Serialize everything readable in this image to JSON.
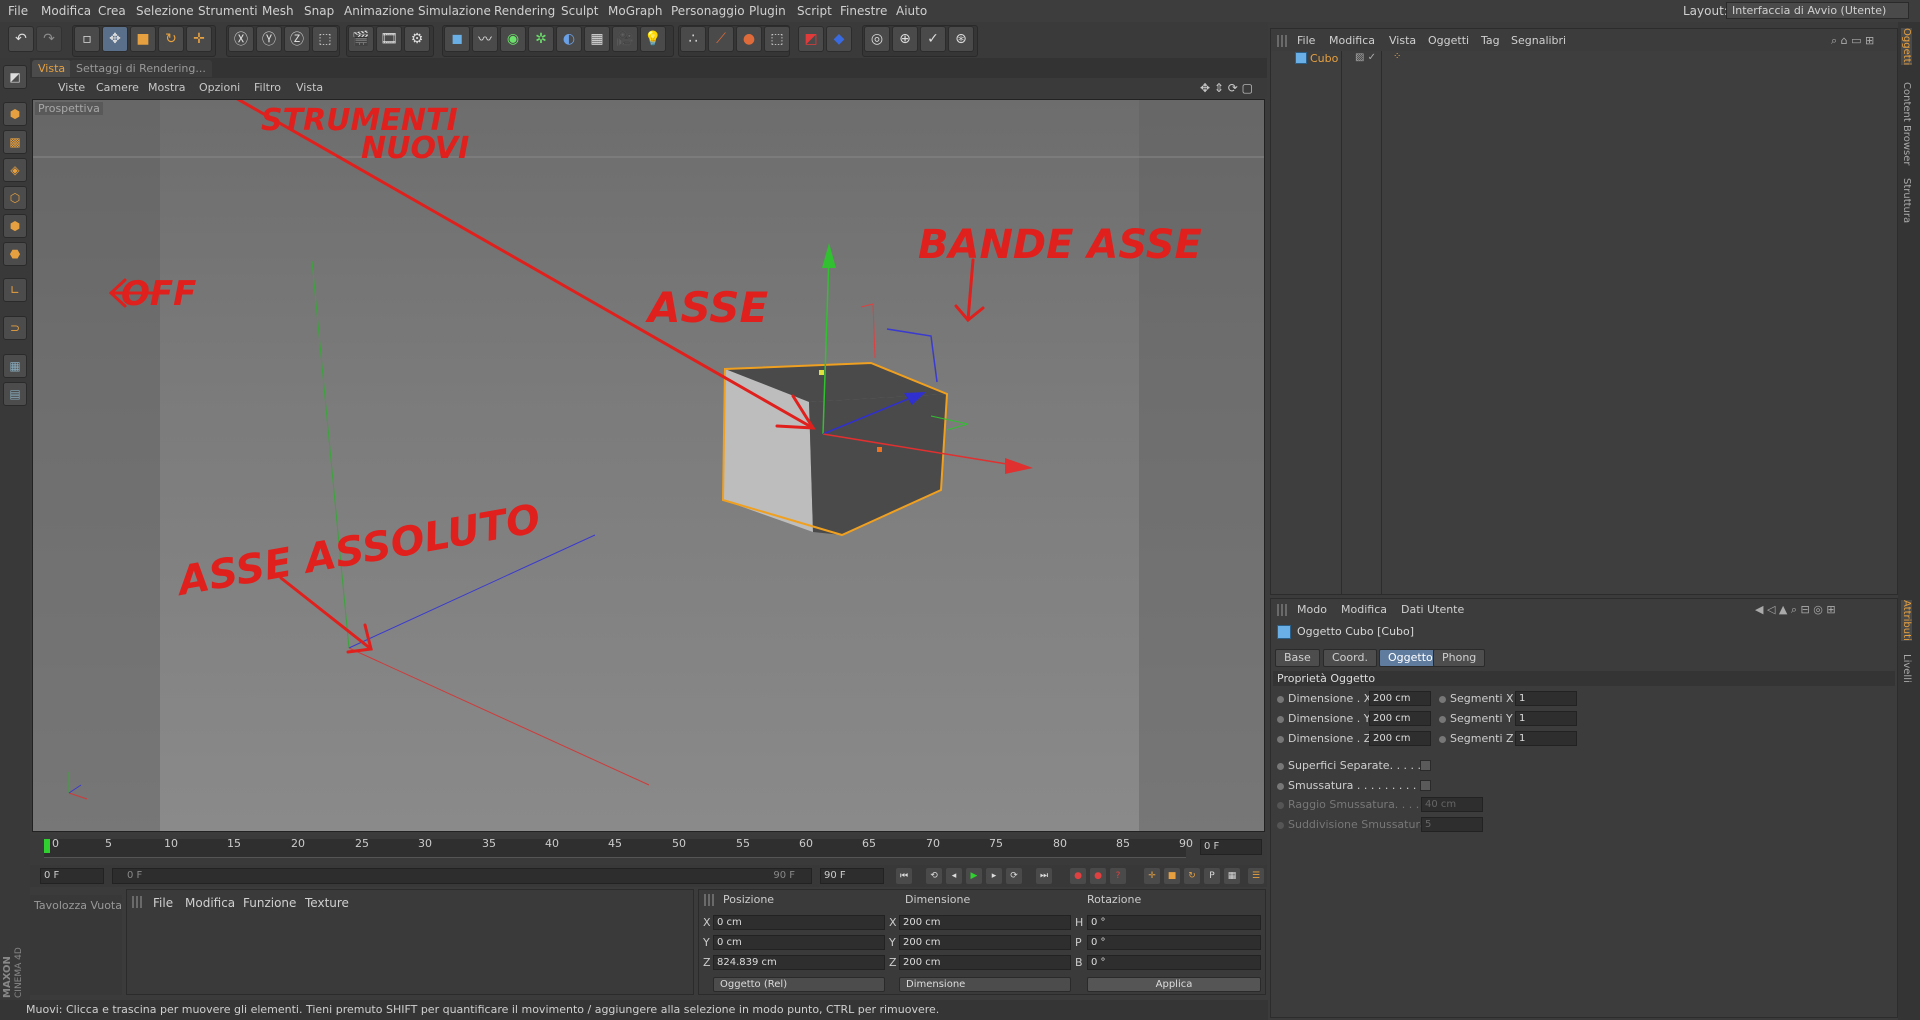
{
  "menubar": {
    "items": [
      "File",
      "Modifica",
      "Crea",
      "Selezione",
      "Strumenti",
      "Mesh",
      "Snap",
      "Animazione",
      "Simulazione",
      "Rendering",
      "Sculpt",
      "MoGraph",
      "Personaggio",
      "Plugin",
      "Script",
      "Finestre",
      "Aiuto"
    ],
    "layout_label": "Layout:",
    "layout_value": "Interfaccia di Avvio (Utente)"
  },
  "viewport": {
    "tabs": [
      "Vista",
      "Settaggi di Rendering..."
    ],
    "menu": [
      "Viste",
      "Camere",
      "Mostra",
      "Opzioni",
      "Filtro",
      "Vista"
    ],
    "label": "Prospettiva"
  },
  "annotations": {
    "strumenti": "STRUMENTI",
    "nuovi": "NUOVI",
    "bande_asse": "BANDE ASSE",
    "asse": "ASSE",
    "off": "OFF",
    "asse_assoluto": "ASSE ASSOLUTO"
  },
  "timeline": {
    "ticks": [
      "0",
      "5",
      "10",
      "15",
      "20",
      "25",
      "30",
      "35",
      "40",
      "45",
      "50",
      "55",
      "60",
      "65",
      "70",
      "75",
      "80",
      "85",
      "90"
    ],
    "current_frame": "0 F",
    "start": "0 F",
    "slider_start": "0 F",
    "slider_end": "90 F",
    "end": "90 F"
  },
  "palette": {
    "label": "Tavolozza Vuota"
  },
  "material_manager": {
    "menu": [
      "File",
      "Modifica",
      "Funzione",
      "Texture"
    ]
  },
  "coordinates": {
    "headers": [
      "Posizione",
      "Dimensione",
      "Rotazione"
    ],
    "pos": [
      {
        "axis": "X",
        "value": "0 cm"
      },
      {
        "axis": "Y",
        "value": "0 cm"
      },
      {
        "axis": "Z",
        "value": "824.839 cm"
      }
    ],
    "size": [
      {
        "axis": "X",
        "value": "200 cm"
      },
      {
        "axis": "Y",
        "value": "200 cm"
      },
      {
        "axis": "Z",
        "value": "200 cm"
      }
    ],
    "rot": [
      {
        "axis": "H",
        "value": "0 °"
      },
      {
        "axis": "P",
        "value": "0 °"
      },
      {
        "axis": "B",
        "value": "0 °"
      }
    ],
    "mode": "Oggetto (Rel)",
    "size_mode": "Dimensione",
    "apply": "Applica"
  },
  "status": "Muovi: Clicca e trascina per muovere gli elementi. Tieni premuto SHIFT per quantificare il movimento / aggiungere alla selezione in modo punto, CTRL per rimuovere.",
  "object_manager": {
    "menu": [
      "File",
      "Modifica",
      "Vista",
      "Oggetti",
      "Tag",
      "Segnalibri"
    ],
    "objects": [
      "Cubo"
    ]
  },
  "attribute_manager": {
    "menu": [
      "Modo",
      "Modifica",
      "Dati Utente"
    ],
    "title": "Oggetto Cubo [Cubo]",
    "tabs": [
      "Base",
      "Coord.",
      "Oggetto",
      "Phong"
    ],
    "selected_tab": "Oggetto",
    "section": "Proprietà Oggetto",
    "dims": [
      {
        "label": "Dimensione . X",
        "value": "200 cm",
        "seg_label": "Segmenti X",
        "seg": "1"
      },
      {
        "label": "Dimensione . Y",
        "value": "200 cm",
        "seg_label": "Segmenti Y",
        "seg": "1"
      },
      {
        "label": "Dimensione . Z",
        "value": "200 cm",
        "seg_label": "Segmenti Z",
        "seg": "1"
      }
    ],
    "superfici": "Superfici Separate. . . . . .",
    "smussatura": "Smussatura . . . . . . . . . . .",
    "raggio": "Raggio Smussatura. . . . .",
    "raggio_value": "40 cm",
    "suddivisione": "Suddivisione Smussatura",
    "suddivisione_value": "5"
  },
  "side_tabs": [
    "Oggetti",
    "Content Browser",
    "Struttura",
    "Attributi",
    "Livelli"
  ],
  "logo": {
    "brand": "MAXON",
    "product": "CINEMA 4D"
  },
  "colors": {
    "accent": "#e6a040",
    "selection": "#5f7c9f",
    "annotation": "#e0201c"
  }
}
